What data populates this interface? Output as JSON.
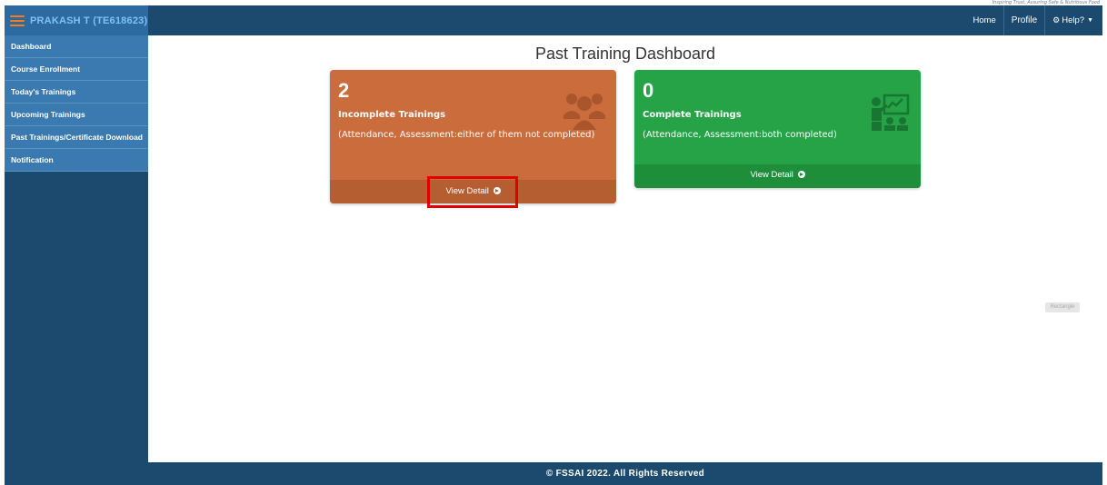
{
  "tagline": "Inspiring Trust, Assuring Safe & Nutritious Food",
  "brand": {
    "user_name": "PRAKASH T (TE618623)"
  },
  "topnav": {
    "home": "Home",
    "profile": "Profile",
    "help": "Help?"
  },
  "sidebar": {
    "items": [
      {
        "label": "Dashboard"
      },
      {
        "label": "Course Enrollment"
      },
      {
        "label": "Today's Trainings"
      },
      {
        "label": "Upcoming Trainings"
      },
      {
        "label": "Past Trainings/Certificate Download"
      },
      {
        "label": "Notification"
      }
    ]
  },
  "main": {
    "title": "Past Training Dashboard",
    "cards": [
      {
        "count": "2",
        "label": "Incomplete Trainings",
        "desc": "(Attendance, Assessment:either of them not completed)",
        "footer": "View Detail",
        "color": "#cb6c3c",
        "icon": "users-group-icon"
      },
      {
        "count": "0",
        "label": "Complete Trainings",
        "desc": "(Attendance, Assessment:both completed)",
        "footer": "View Detail",
        "color": "#26a347",
        "icon": "classroom-presentation-icon"
      }
    ]
  },
  "badge": "Rectangle",
  "footer": {
    "copyright": "© FSSAI 2022. All Rights Reserved"
  },
  "colors": {
    "topbar": "#1c4a6e",
    "sidebar_item": "#3a7ab0",
    "highlight": "#e10000"
  }
}
